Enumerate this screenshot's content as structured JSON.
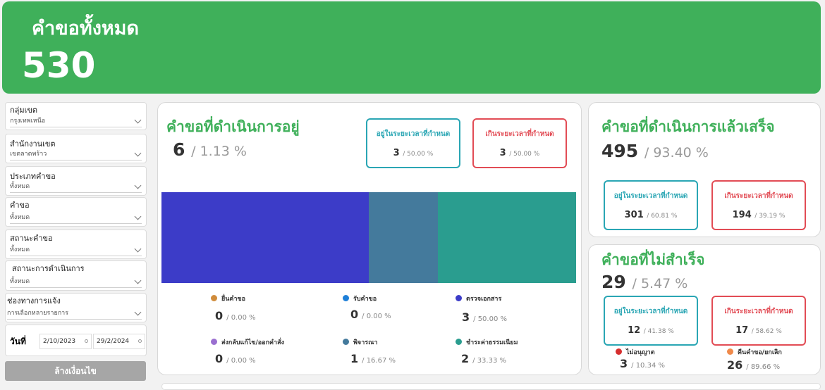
{
  "banner": {
    "title": "คำขอทั้งหมด",
    "value": "530"
  },
  "filters": [
    {
      "label": "กลุ่มเขต",
      "value": "กรุงเทพเหนือ"
    },
    {
      "label": "สำนักงานเขต",
      "value": "เขตลาดพร้าว"
    },
    {
      "label": "ประเภทคำขอ",
      "value": "ทั้งหมด"
    },
    {
      "label": "คำขอ",
      "value": "ทั้งหมด"
    },
    {
      "label": "สถานะคำขอ",
      "value": "ทั้งหมด"
    },
    {
      "label": "สถานะการดำเนินการ",
      "value": "ทั้งหมด"
    },
    {
      "label": "ช่องทางการแจ้ง",
      "value": "การเลือกหลายรายการ"
    }
  ],
  "date": {
    "label": "วันที่",
    "start": "2/10/2023",
    "end": "29/2/2024"
  },
  "clear_button": "ล้างเงื่อนไข",
  "in_progress": {
    "title": "คำขอที่ดำเนินการอยู่",
    "count": "6",
    "pct": "/ 1.13 %",
    "on_time": {
      "label": "อยู่ในระยะเวลาที่กำหนด",
      "count": "3",
      "pct": "/ 50.00 %"
    },
    "overdue": {
      "label": "เกินระยะเวลาที่กำหนด",
      "count": "3",
      "pct": "/ 50.00 %"
    },
    "legend": [
      {
        "name": "ยื่นคำขอ",
        "color": "#d08c3c",
        "count": "0",
        "pct": "/ 0.00 %"
      },
      {
        "name": "รับคำขอ",
        "color": "#1e7fd8",
        "count": "0",
        "pct": "/ 0.00 %"
      },
      {
        "name": "ตรวจเอกสาร",
        "color": "#3c3cc8",
        "count": "3",
        "pct": "/ 50.00 %"
      },
      {
        "name": "ส่งกลับแก้ไข/ออกคำสั่ง",
        "color": "#9a6fd0",
        "count": "0",
        "pct": "/ 0.00 %"
      },
      {
        "name": "พิจารณา",
        "color": "#447a9c",
        "count": "1",
        "pct": "/ 16.67 %"
      },
      {
        "name": "ชำระค่าธรรมเนียม",
        "color": "#2a9d8f",
        "count": "2",
        "pct": "/ 33.33 %"
      }
    ]
  },
  "completed": {
    "title": "คำขอที่ดำเนินการแล้วเสร็จ",
    "count": "495",
    "pct": "/ 93.40 %",
    "on_time": {
      "label": "อยู่ในระยะเวลาที่กำหนด",
      "count": "301",
      "pct": "/ 60.81 %"
    },
    "overdue": {
      "label": "เกินระยะเวลาที่กำหนด",
      "count": "194",
      "pct": "/ 39.19 %"
    }
  },
  "failed": {
    "title": "คำขอที่ไม่สำเร็จ",
    "count": "29",
    "pct": "/ 5.47 %",
    "on_time": {
      "label": "อยู่ในระยะเวลาที่กำหนด",
      "count": "12",
      "pct": "/ 41.38 %"
    },
    "overdue": {
      "label": "เกินระยะเวลาที่กำหนด",
      "count": "17",
      "pct": "/ 58.62 %"
    },
    "legend": [
      {
        "name": "ไม่อนุญาต",
        "color": "#d62e2e",
        "count": "3",
        "pct": "/ 10.34 %"
      },
      {
        "name": "คืนคำขอ/ยกเลิก",
        "color": "#f08a4b",
        "count": "26",
        "pct": "/ 89.66 %"
      }
    ]
  },
  "chart_data": {
    "type": "bar",
    "stacked": true,
    "categories": [
      "ตรวจเอกสาร",
      "พิจารณา",
      "ชำระค่าธรรมเนียม"
    ],
    "values": [
      3,
      1,
      2
    ],
    "colors": [
      "#3c3cc8",
      "#447a9c",
      "#2a9d8f"
    ]
  }
}
